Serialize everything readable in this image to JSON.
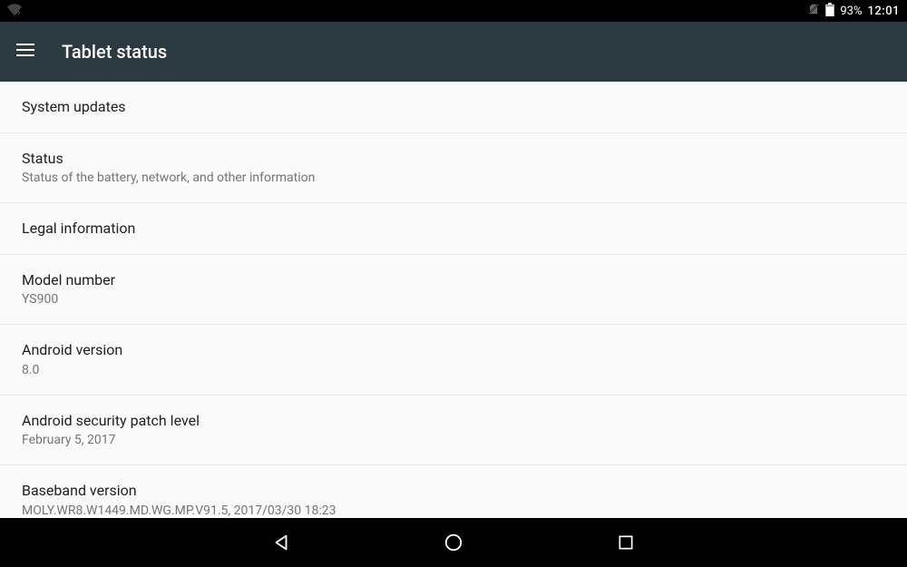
{
  "status_bar": {
    "battery_pct": "93%",
    "clock": "12:01"
  },
  "app_bar": {
    "title": "Tablet status"
  },
  "rows": [
    {
      "title": "System updates",
      "sub": null
    },
    {
      "title": "Status",
      "sub": "Status of the battery, network, and other information"
    },
    {
      "title": "Legal information",
      "sub": null
    },
    {
      "title": "Model number",
      "sub": "YS900"
    },
    {
      "title": "Android version",
      "sub": "8.0"
    },
    {
      "title": "Android security patch level",
      "sub": "February 5, 2017"
    },
    {
      "title": "Baseband version",
      "sub": "MOLY.WR8.W1449.MD.WG.MP.V91.5, 2017/03/30 18:23"
    }
  ]
}
